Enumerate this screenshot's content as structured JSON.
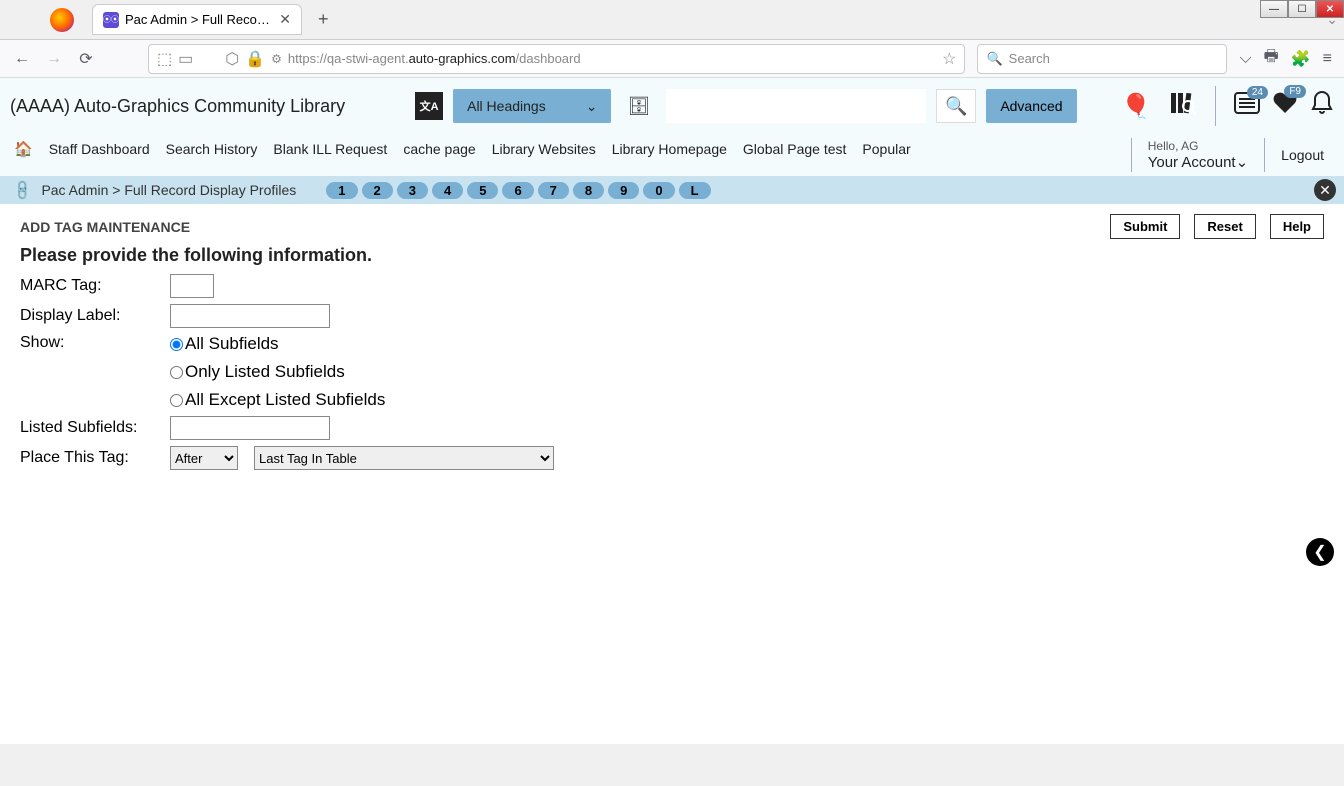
{
  "browser": {
    "tab_title": "Pac Admin > Full Record Displa",
    "url_prefix": "https://qa-stwi-agent.",
    "url_domain": "auto-graphics.com",
    "url_path": "/dashboard",
    "search_placeholder": "Search"
  },
  "header": {
    "org": "(AAAA) Auto-Graphics Community Library",
    "headings_label": "All Headings",
    "advanced": "Advanced",
    "greeting": "Hello, AG",
    "account": "Your Account",
    "logout": "Logout",
    "badge_list": "24",
    "badge_heart": "F9"
  },
  "nav": {
    "items": [
      "Staff Dashboard",
      "Search History",
      "Blank ILL Request",
      "cache page",
      "Library Websites",
      "Library Homepage",
      "Global Page test",
      "Popular"
    ]
  },
  "crumb": {
    "text": "Pac Admin > Full Record Display Profiles",
    "pills": [
      "1",
      "2",
      "3",
      "4",
      "5",
      "6",
      "7",
      "8",
      "9",
      "0",
      "L"
    ]
  },
  "form": {
    "title": "ADD TAG MAINTENANCE",
    "submit": "Submit",
    "reset": "Reset",
    "help": "Help",
    "subtitle": "Please provide the following information.",
    "labels": {
      "marc": "MARC Tag:",
      "display": "Display Label:",
      "show": "Show:",
      "listed": "Listed Subfields:",
      "place": "Place This Tag:"
    },
    "radios": {
      "all": "All Subfields",
      "only": "Only Listed Subfields",
      "except": "All Except Listed Subfields"
    },
    "place_pos": "After",
    "place_target": "Last Tag In Table"
  }
}
